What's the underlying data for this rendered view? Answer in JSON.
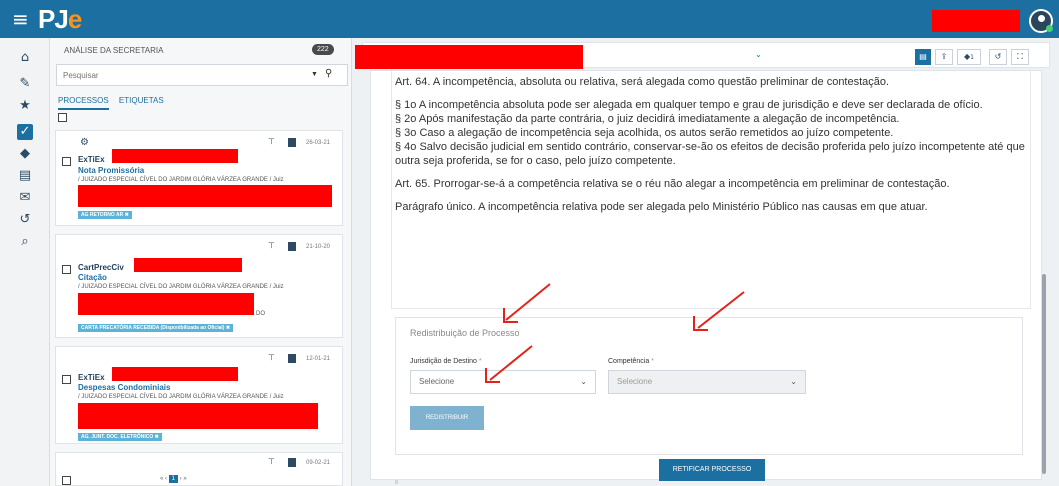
{
  "topbar": {
    "logo_main": "PJ",
    "logo_accent": "e"
  },
  "sidebar_icons": [
    "home-icon",
    "pencil-icon",
    "star-icon",
    "checkbox-icon",
    "tags-icon",
    "layers-icon",
    "envelope-icon",
    "history-icon",
    "search-icon"
  ],
  "left_panel": {
    "heading": "ANÁLISE DA SECRETARIA",
    "count": "222",
    "search_placeholder": "Pesquisar",
    "tabs": [
      "PROCESSOS",
      "ETIQUETAS"
    ],
    "cards": [
      {
        "date": "26-03-21",
        "class": "ExTiEx",
        "subject": "Nota Promissória",
        "org": "/ JUIZADO ESPECIAL CÍVEL DO JARDIM GLÓRIA VÁRZEA GRANDE / Juiz",
        "tag": "AG RETORNO AR ✖"
      },
      {
        "date": "21-10-20",
        "class": "CartPrecCiv",
        "subject": "Citação",
        "org": "/ JUIZADO ESPECIAL CÍVEL DO JARDIM GLÓRIA VÁRZEA GRANDE / Juiz",
        "extra": "DO",
        "tag": "CARTA PRECATÓRIA RECEBIDA (Disponibilizada ao Oficial) ✖"
      },
      {
        "date": "12-01-21",
        "class": "ExTiEx",
        "subject": "Despesas Condominiais",
        "org": "/ JUIZADO ESPECIAL CÍVEL DO JARDIM GLÓRIA VÁRZEA GRANDE / Juiz",
        "tag": "AG. JUNT. DOC. ELETRÔNICO ✖"
      },
      {
        "date": "09-02-21"
      }
    ],
    "pager_current": "1"
  },
  "law_text": {
    "art64": "Art. 64. A incompetência, absoluta ou relativa, será alegada como questão preliminar de contestação.",
    "p1": "§ 1o A incompetência absoluta pode ser alegada em qualquer tempo e grau de jurisdição e deve ser declarada de ofício.",
    "p2": "§ 2o Após manifestação da parte contrária, o juiz decidirá imediatamente a alegação de incompetência.",
    "p3": "§ 3o Caso a alegação de incompetência seja acolhida, os autos serão remetidos ao juízo competente.",
    "p4": "§ 4o Salvo decisão judicial em sentido contrário, conservar-se-ão os efeitos de decisão proferida pelo juízo incompetente até que outra seja proferida, se for o caso, pelo juízo competente.",
    "art65": "Art. 65. Prorrogar-se-á a competência relativa se o réu não alegar a incompetência em preliminar de contestação.",
    "par": "Parágrafo único. A incompetência relativa pode ser alegada pelo Ministério Público nas causas em que atuar."
  },
  "redistribution": {
    "title": "Redistribuição de Processo",
    "jurisdicao_label": "Jurisdição de Destino",
    "competencia_label": "Competência",
    "required_mark": "*",
    "jurisdicao_value": "Selecione",
    "competencia_value": "Selecione",
    "button": "REDISTRIBUIR"
  },
  "retificar_button": "RETIFICAR PROCESSO",
  "toolbar": {
    "tag_count": "1"
  },
  "colors": {
    "topbar": "#1b6fa1",
    "logo_accent": "#f7941d",
    "redaction": "#ff0000",
    "annotation_arrow": "#e2231a"
  }
}
